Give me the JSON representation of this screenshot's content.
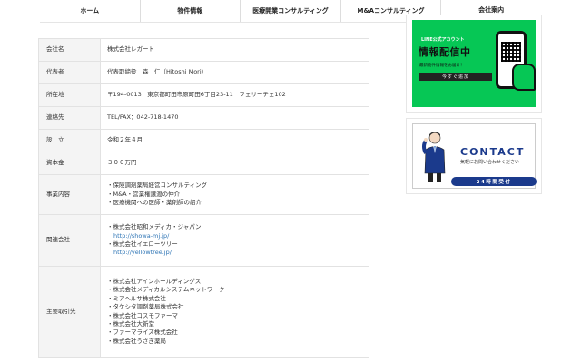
{
  "nav": {
    "items": [
      "ホーム",
      "物件情報",
      "医療開業コンサルティング",
      "M&Aコンサルティング",
      "会社案内"
    ],
    "active_index": 4
  },
  "company": {
    "rows": [
      {
        "label": "会社名",
        "value": "株式会社レガート"
      },
      {
        "label": "代表者",
        "value": "代表取締役　森　仁（Hitoshi Mori）"
      },
      {
        "label": "所在地",
        "value": "〒194-0013　東京都町田市原町田6丁目23-11　フェリーチェ102"
      },
      {
        "label": "連絡先",
        "value": "TEL/FAX：042-718-1470"
      },
      {
        "label": "設　立",
        "value": "令和２年４月"
      },
      {
        "label": "資本金",
        "value": "３００万円"
      }
    ],
    "business": {
      "label": "事業内容",
      "items": [
        "保険調剤薬局経営コンサルティング",
        "M&A・営業権譲渡の仲介",
        "医療機関への医師・薬剤師の紹介"
      ]
    },
    "related": {
      "label": "関連会社",
      "company1": "株式会社昭和メディカ・ジャパン",
      "link1": "http://showa-mj.jp/",
      "company2": "株式会社イエローツリー",
      "link2": "http://yellowtree.jp/"
    },
    "partners": {
      "label": "主要取引先",
      "items": [
        "株式会社アインホールディングス",
        "株式会社メディカルシステムネットワーク",
        "ミアヘルサ株式会社",
        "タケシタ調剤薬局株式会社",
        "株式会社コスモファーマ",
        "株式会社大新堂",
        "ファーマライズ株式会社",
        "株式会社うさぎ薬局"
      ]
    }
  },
  "sidebar": {
    "line": {
      "small": "LINE公式アカウント",
      "big": "情報配信中",
      "desc": "最新物件情報をお届け！",
      "button": "今すぐ追加",
      "color": "#06c755"
    },
    "contact": {
      "title": "CONTACT",
      "sub": "気軽にお問い合わせください",
      "button": "24時間受付",
      "color": "#1b3a8c"
    }
  }
}
